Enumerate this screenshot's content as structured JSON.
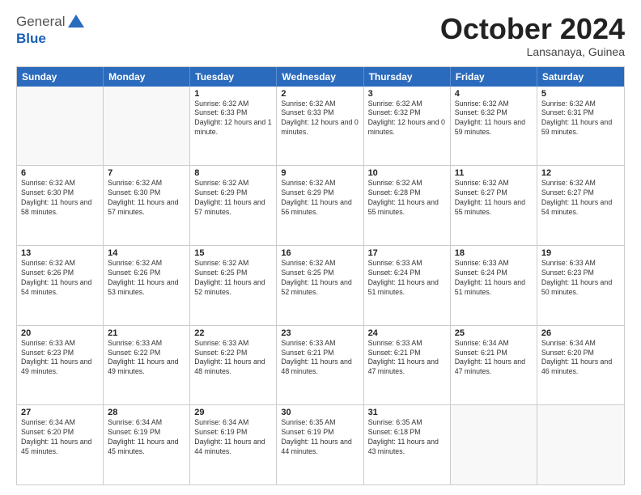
{
  "header": {
    "logo": {
      "general": "General",
      "blue": "Blue",
      "tagline": ""
    },
    "title": "October 2024",
    "subtitle": "Lansanaya, Guinea"
  },
  "weekdays": [
    "Sunday",
    "Monday",
    "Tuesday",
    "Wednesday",
    "Thursday",
    "Friday",
    "Saturday"
  ],
  "rows": [
    [
      {
        "day": "",
        "info": "",
        "empty": true
      },
      {
        "day": "",
        "info": "",
        "empty": true
      },
      {
        "day": "1",
        "info": "Sunrise: 6:32 AM\nSunset: 6:33 PM\nDaylight: 12 hours and 1 minute."
      },
      {
        "day": "2",
        "info": "Sunrise: 6:32 AM\nSunset: 6:33 PM\nDaylight: 12 hours and 0 minutes."
      },
      {
        "day": "3",
        "info": "Sunrise: 6:32 AM\nSunset: 6:32 PM\nDaylight: 12 hours and 0 minutes."
      },
      {
        "day": "4",
        "info": "Sunrise: 6:32 AM\nSunset: 6:32 PM\nDaylight: 11 hours and 59 minutes."
      },
      {
        "day": "5",
        "info": "Sunrise: 6:32 AM\nSunset: 6:31 PM\nDaylight: 11 hours and 59 minutes."
      }
    ],
    [
      {
        "day": "6",
        "info": "Sunrise: 6:32 AM\nSunset: 6:30 PM\nDaylight: 11 hours and 58 minutes."
      },
      {
        "day": "7",
        "info": "Sunrise: 6:32 AM\nSunset: 6:30 PM\nDaylight: 11 hours and 57 minutes."
      },
      {
        "day": "8",
        "info": "Sunrise: 6:32 AM\nSunset: 6:29 PM\nDaylight: 11 hours and 57 minutes."
      },
      {
        "day": "9",
        "info": "Sunrise: 6:32 AM\nSunset: 6:29 PM\nDaylight: 11 hours and 56 minutes."
      },
      {
        "day": "10",
        "info": "Sunrise: 6:32 AM\nSunset: 6:28 PM\nDaylight: 11 hours and 55 minutes."
      },
      {
        "day": "11",
        "info": "Sunrise: 6:32 AM\nSunset: 6:27 PM\nDaylight: 11 hours and 55 minutes."
      },
      {
        "day": "12",
        "info": "Sunrise: 6:32 AM\nSunset: 6:27 PM\nDaylight: 11 hours and 54 minutes."
      }
    ],
    [
      {
        "day": "13",
        "info": "Sunrise: 6:32 AM\nSunset: 6:26 PM\nDaylight: 11 hours and 54 minutes."
      },
      {
        "day": "14",
        "info": "Sunrise: 6:32 AM\nSunset: 6:26 PM\nDaylight: 11 hours and 53 minutes."
      },
      {
        "day": "15",
        "info": "Sunrise: 6:32 AM\nSunset: 6:25 PM\nDaylight: 11 hours and 52 minutes."
      },
      {
        "day": "16",
        "info": "Sunrise: 6:32 AM\nSunset: 6:25 PM\nDaylight: 11 hours and 52 minutes."
      },
      {
        "day": "17",
        "info": "Sunrise: 6:33 AM\nSunset: 6:24 PM\nDaylight: 11 hours and 51 minutes."
      },
      {
        "day": "18",
        "info": "Sunrise: 6:33 AM\nSunset: 6:24 PM\nDaylight: 11 hours and 51 minutes."
      },
      {
        "day": "19",
        "info": "Sunrise: 6:33 AM\nSunset: 6:23 PM\nDaylight: 11 hours and 50 minutes."
      }
    ],
    [
      {
        "day": "20",
        "info": "Sunrise: 6:33 AM\nSunset: 6:23 PM\nDaylight: 11 hours and 49 minutes."
      },
      {
        "day": "21",
        "info": "Sunrise: 6:33 AM\nSunset: 6:22 PM\nDaylight: 11 hours and 49 minutes."
      },
      {
        "day": "22",
        "info": "Sunrise: 6:33 AM\nSunset: 6:22 PM\nDaylight: 11 hours and 48 minutes."
      },
      {
        "day": "23",
        "info": "Sunrise: 6:33 AM\nSunset: 6:21 PM\nDaylight: 11 hours and 48 minutes."
      },
      {
        "day": "24",
        "info": "Sunrise: 6:33 AM\nSunset: 6:21 PM\nDaylight: 11 hours and 47 minutes."
      },
      {
        "day": "25",
        "info": "Sunrise: 6:34 AM\nSunset: 6:21 PM\nDaylight: 11 hours and 47 minutes."
      },
      {
        "day": "26",
        "info": "Sunrise: 6:34 AM\nSunset: 6:20 PM\nDaylight: 11 hours and 46 minutes."
      }
    ],
    [
      {
        "day": "27",
        "info": "Sunrise: 6:34 AM\nSunset: 6:20 PM\nDaylight: 11 hours and 45 minutes."
      },
      {
        "day": "28",
        "info": "Sunrise: 6:34 AM\nSunset: 6:19 PM\nDaylight: 11 hours and 45 minutes."
      },
      {
        "day": "29",
        "info": "Sunrise: 6:34 AM\nSunset: 6:19 PM\nDaylight: 11 hours and 44 minutes."
      },
      {
        "day": "30",
        "info": "Sunrise: 6:35 AM\nSunset: 6:19 PM\nDaylight: 11 hours and 44 minutes."
      },
      {
        "day": "31",
        "info": "Sunrise: 6:35 AM\nSunset: 6:18 PM\nDaylight: 11 hours and 43 minutes."
      },
      {
        "day": "",
        "info": "",
        "empty": true
      },
      {
        "day": "",
        "info": "",
        "empty": true
      }
    ]
  ]
}
